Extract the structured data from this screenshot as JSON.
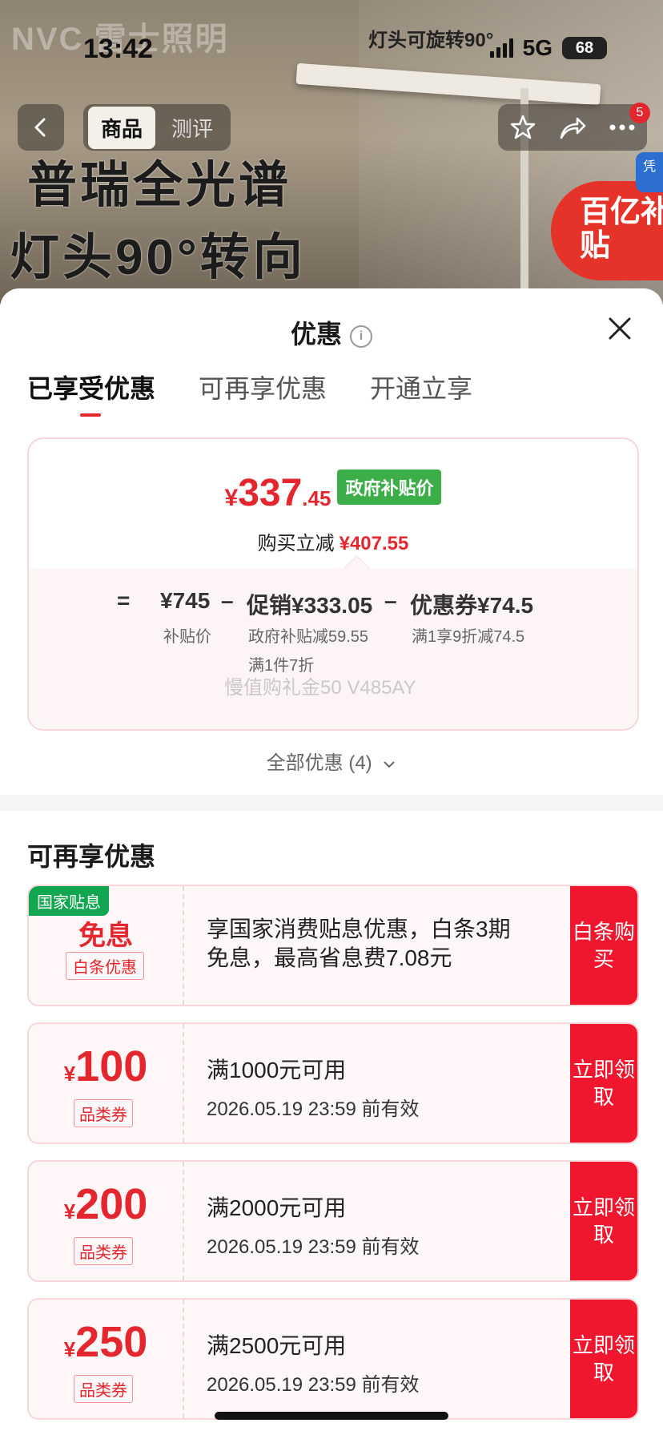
{
  "status_bar": {
    "time": "13:42",
    "network": "5G",
    "battery": "68"
  },
  "banner": {
    "brand": "NVC 雷士照明",
    "rotate_note": "灯头可旋转90°",
    "headline_1": "普瑞全光谱",
    "headline_2": "灯头90°转向",
    "subsidy_corner": "百亿补贴",
    "side_tag": "凭"
  },
  "nav": {
    "tabs": [
      {
        "label": "商品"
      },
      {
        "label": "测评"
      }
    ],
    "cart_badge": "5"
  },
  "sheet": {
    "title": "优惠",
    "tabs": [
      {
        "label": "已享受优惠"
      },
      {
        "label": "可再享优惠"
      },
      {
        "label": "开通立享"
      }
    ],
    "price_card": {
      "currency": "¥",
      "price_int": "337",
      "price_dec": ".45",
      "price_tag": "政府补贴价",
      "instant_label": "购买立减",
      "instant_value": "¥407.55",
      "eq": "=",
      "base_price": "¥745",
      "base_label": "补贴价",
      "minus1": "–",
      "promo": "促销¥333.05",
      "promo_detail_1": "政府补贴减59.55",
      "promo_detail_2": "满1件7折",
      "minus2": "–",
      "coupon": "优惠券¥74.5",
      "coupon_detail": "满1享9折减74.5",
      "watermark": "慢值购礼金50 V485AY"
    },
    "all_offers": "全部优惠 (4)",
    "more_title": "可再享优惠",
    "interest_free": {
      "tag": "国家贴息",
      "title": "免息",
      "sub": "白条优惠",
      "desc": "享国家消费贴息优惠，白条3期免息，最高省息费7.08元",
      "button": "白条购买"
    },
    "coupons": [
      {
        "amount": "100",
        "kind": "品类券",
        "condition": "满1000元可用",
        "expiry": "2026.05.19 23:59 前有效",
        "button": "立即领取"
      },
      {
        "amount": "200",
        "kind": "品类券",
        "condition": "满2000元可用",
        "expiry": "2026.05.19 23:59 前有效",
        "button": "立即领取"
      },
      {
        "amount": "250",
        "kind": "品类券",
        "condition": "满2500元可用",
        "expiry": "2026.05.19 23:59 前有效",
        "button": "立即领取"
      }
    ],
    "yen": "¥"
  },
  "colors": {
    "accent_red": "#e4262e",
    "button_red": "#f0162e",
    "gov_green": "#3cae48",
    "tag_green": "#13a650"
  },
  "icons": [
    "back-icon",
    "star-icon",
    "share-icon",
    "more-icon",
    "info-icon",
    "close-icon",
    "chevron-down-icon"
  ]
}
